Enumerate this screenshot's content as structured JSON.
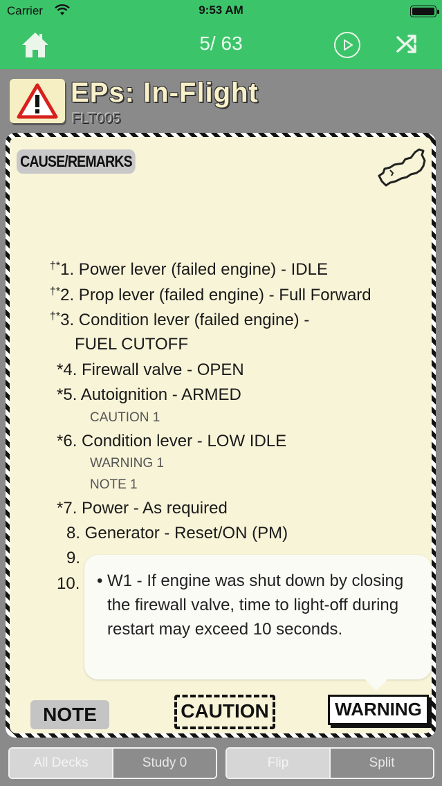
{
  "status_bar": {
    "carrier": "Carrier",
    "time": "9:53 AM"
  },
  "nav": {
    "counter": "5/ 63"
  },
  "header": {
    "title": "EPs:  In-Flight",
    "code": "FLT005"
  },
  "card": {
    "tag": "CAUSE/REMARKS",
    "steps": [
      {
        "prefix": "†*",
        "text": "1. Power lever (failed engine) - IDLE"
      },
      {
        "prefix": "†*",
        "text": "2. Prop lever (failed engine) - Full Forward"
      },
      {
        "prefix": "†*",
        "text": "3. Condition lever (failed engine) -"
      },
      {
        "prefix": "",
        "text": "FUEL CUTOFF"
      },
      {
        "prefix": "",
        "text": "*4. Firewall valve - OPEN"
      },
      {
        "prefix": "",
        "text": "*5. Autoignition - ARMED"
      },
      {
        "prefix": "",
        "text": "*6. Condition lever - LOW IDLE"
      },
      {
        "prefix": "",
        "text": "*7. Power - As required"
      },
      {
        "prefix": "",
        "text": "8. Generator - Reset/ON (PM)"
      },
      {
        "prefix": "",
        "text": "9."
      },
      {
        "prefix": "",
        "text": "10."
      }
    ],
    "subs": [
      "CAUTION 1",
      "WARNING 1",
      "NOTE 1"
    ],
    "tooltip": "W1 - If engine was shut down by closing the firewall valve, time to light-off during restart may exceed 10 seconds.",
    "buttons": {
      "note": "NOTE",
      "caution": "CAUTION",
      "warning": "WARNING"
    }
  },
  "bottom": {
    "all_decks": "All Decks",
    "study": "Study 0",
    "flip": "Flip",
    "split": "Split"
  },
  "colors": {
    "accent": "#3cc46a",
    "card": "#f8f4d8",
    "background": "#8a8a8a"
  }
}
